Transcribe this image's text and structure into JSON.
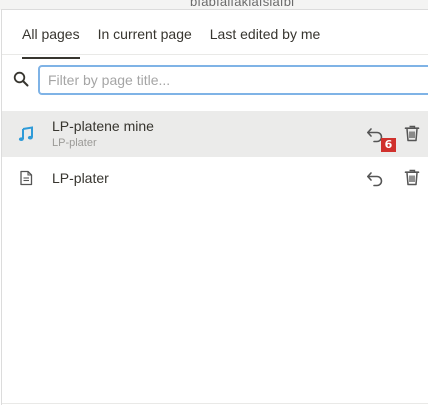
{
  "header": {
    "strip_text": "bfabfaifakiafsiafbi"
  },
  "tabs": [
    {
      "label": "All pages",
      "active": true
    },
    {
      "label": "In current page",
      "active": false
    },
    {
      "label": "Last edited by me",
      "active": false
    }
  ],
  "search": {
    "placeholder": "Filter by page title...",
    "value": ""
  },
  "pages": [
    {
      "title": "LP-platene mine",
      "subtitle": "LP-plater",
      "icon": "music-note-icon",
      "selected": true,
      "badge": "6"
    },
    {
      "title": "LP-plater",
      "subtitle": "",
      "icon": "page-icon",
      "selected": false
    }
  ],
  "colors": {
    "accent_icon": "#2f9bd8",
    "badge": "#d0312d",
    "search_border": "#7fb3e6",
    "selected_row": "#ebebea"
  }
}
